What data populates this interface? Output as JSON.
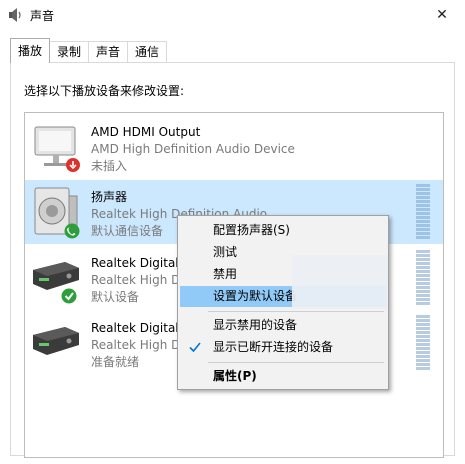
{
  "window": {
    "title": "声音"
  },
  "tabs": [
    {
      "label": "播放"
    },
    {
      "label": "录制"
    },
    {
      "label": "声音"
    },
    {
      "label": "通信"
    }
  ],
  "instruction": "选择以下播放设备来修改设置:",
  "devices": [
    {
      "name": "AMD HDMI Output",
      "driver": "AMD High Definition Audio Device",
      "status": "未插入",
      "icon": "monitor-icon",
      "badge": "unplugged-badge"
    },
    {
      "name": "扬声器",
      "driver": "Realtek High Definition Audio",
      "status": "默认通信设备",
      "icon": "speaker-icon",
      "badge": "phone-badge"
    },
    {
      "name": "Realtek Digital",
      "driver": "Realtek High D",
      "status": "默认设备",
      "icon": "receiver-icon",
      "badge": "check-badge"
    },
    {
      "name": "Realtek Digital",
      "driver": "Realtek High D",
      "status": "准备就绪",
      "icon": "receiver-icon",
      "badge": ""
    }
  ],
  "context_menu": {
    "items": [
      {
        "label": "配置扬声器(S)"
      },
      {
        "label": "测试"
      },
      {
        "label": "禁用"
      },
      {
        "label": "设置为默认设备"
      },
      {
        "label": "显示禁用的设备"
      },
      {
        "label": "显示已断开连接的设备",
        "checked": true
      },
      {
        "label": "属性(P)"
      }
    ]
  },
  "colors": {
    "selection": "#cce8ff",
    "menu_highlight": "#91c9f7",
    "check": "#0078d7"
  }
}
